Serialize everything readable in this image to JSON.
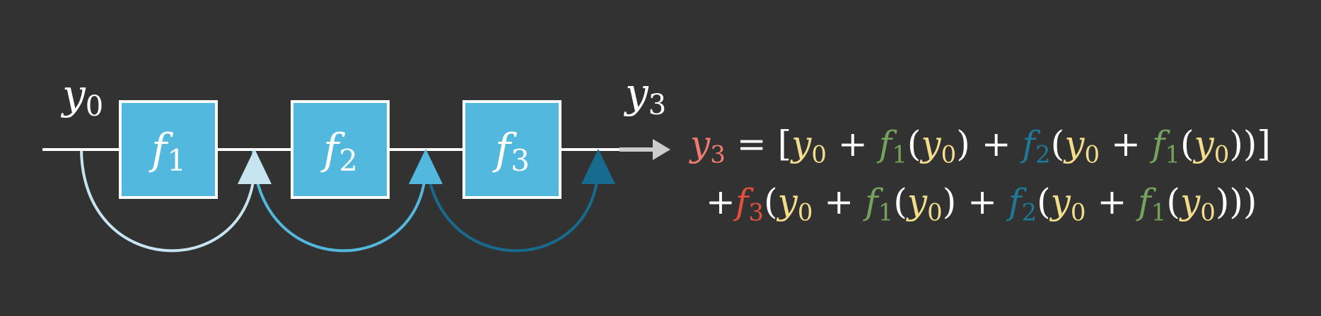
{
  "diagram": {
    "input_label": {
      "base": "y",
      "sub": "0"
    },
    "output_label": {
      "base": "y",
      "sub": "3"
    },
    "blocks": [
      {
        "base": "f",
        "sub": "1"
      },
      {
        "base": "f",
        "sub": "2"
      },
      {
        "base": "f",
        "sub": "3"
      }
    ],
    "colors": {
      "background": "#323232",
      "block_fill": "#52b8de",
      "block_stroke": "#ffffff",
      "line": "#ffffff",
      "arrow_head": "#cccccc",
      "skip_1": "#c7e4f1",
      "skip_2": "#52b8de",
      "skip_3": "#166b8e"
    }
  },
  "equation": {
    "line1": {
      "lhs": {
        "base": "y",
        "sub": "3"
      },
      "eq": "=",
      "open": "[",
      "plus": "+",
      "y0": {
        "base": "y",
        "sub": "0"
      },
      "f1": {
        "base": "f",
        "sub": "1"
      },
      "f2": {
        "base": "f",
        "sub": "2"
      },
      "lp": "(",
      "rp": ")",
      "close": "]"
    },
    "line2": {
      "plus": "+",
      "f3": {
        "base": "f",
        "sub": "3"
      },
      "y0": {
        "base": "y",
        "sub": "0"
      },
      "f1": {
        "base": "f",
        "sub": "1"
      },
      "f2": {
        "base": "f",
        "sub": "2"
      },
      "lp": "(",
      "rp": ")"
    },
    "colors": {
      "output": "#f07c70",
      "y0": "#f3dd8c",
      "f1": "#75a35b",
      "f2": "#1e7898",
      "f3": "#e24f3c",
      "operator": "#ffffff"
    }
  }
}
